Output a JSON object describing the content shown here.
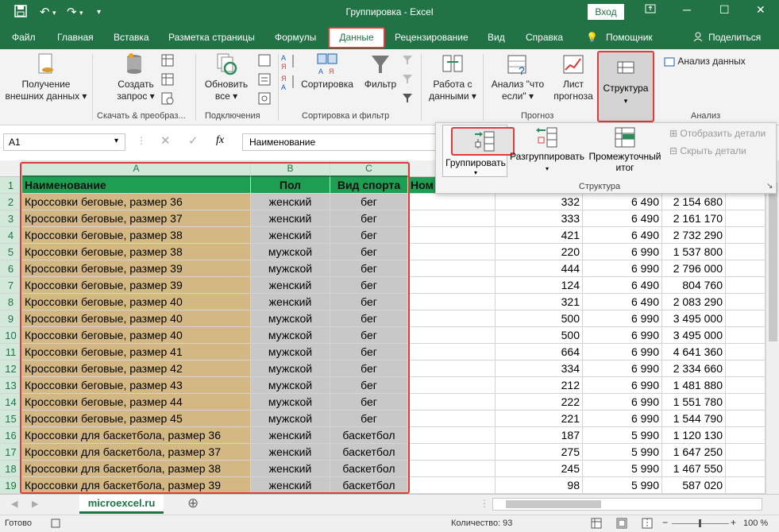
{
  "titlebar": {
    "title": "Группировка - Excel",
    "login": "Вход",
    "win_min": "─",
    "win_restore": "❐",
    "win_max": "☐",
    "win_close": "✕"
  },
  "tabs": {
    "file": "Файл",
    "home": "Главная",
    "insert": "Вставка",
    "layout": "Разметка страницы",
    "formulas": "Формулы",
    "data": "Данные",
    "review": "Рецензирование",
    "view": "Вид",
    "help": "Справка",
    "assistant": "Помощник",
    "share": "Поделиться"
  },
  "ribbon": {
    "get_data_1": "Получение",
    "get_data_2": "внешних данных",
    "create_query_1": "Создать",
    "create_query_2": "запрос",
    "group_download": "Скачать & преобраз...",
    "refresh_1": "Обновить",
    "refresh_2": "все",
    "group_connections": "Подключения",
    "sort": "Сортировка",
    "filter": "Фильтр",
    "group_sort": "Сортировка и фильтр",
    "datatools_1": "Работа с",
    "datatools_2": "данными",
    "whatif_1": "Анализ \"что",
    "whatif_2": "если\"",
    "forecast_1": "Лист",
    "forecast_2": "прогноза",
    "group_forecast": "Прогноз",
    "structure": "Структура",
    "analysis": "Анализ данных",
    "group_analysis": "Анализ"
  },
  "formulabar": {
    "namebox": "A1",
    "formula": "Наименование"
  },
  "struct_panel": {
    "group": "Группировать",
    "ungroup": "Разгруппировать",
    "subtotal_1": "Промежуточный",
    "subtotal_2": "итог",
    "show_detail": "Отобразить детали",
    "hide_detail": "Скрыть детали",
    "label": "Структура"
  },
  "grid": {
    "columns": [
      "A",
      "B",
      "C"
    ],
    "header": [
      "Наименование",
      "Пол",
      "Вид спорта",
      "Ном"
    ],
    "rows": [
      [
        "2",
        "Кроссовки беговые, размер 36",
        "женский",
        "бег",
        "332",
        "6 490",
        "2 154 680"
      ],
      [
        "3",
        "Кроссовки беговые, размер 37",
        "женский",
        "бег",
        "333",
        "6 490",
        "2 161 170"
      ],
      [
        "4",
        "Кроссовки беговые, размер 38",
        "женский",
        "бег",
        "421",
        "6 490",
        "2 732 290"
      ],
      [
        "5",
        "Кроссовки беговые, размер 38",
        "мужской",
        "бег",
        "220",
        "6 990",
        "1 537 800"
      ],
      [
        "6",
        "Кроссовки беговые, размер 39",
        "мужской",
        "бег",
        "444",
        "6 990",
        "2 796 000"
      ],
      [
        "7",
        "Кроссовки беговые, размер 39",
        "женский",
        "бег",
        "124",
        "6 490",
        "804 760"
      ],
      [
        "8",
        "Кроссовки беговые, размер 40",
        "женский",
        "бег",
        "321",
        "6 490",
        "2 083 290"
      ],
      [
        "9",
        "Кроссовки беговые, размер 40",
        "мужской",
        "бег",
        "500",
        "6 990",
        "3 495 000"
      ],
      [
        "10",
        "Кроссовки беговые, размер 40",
        "мужской",
        "бег",
        "500",
        "6 990",
        "3 495 000"
      ],
      [
        "11",
        "Кроссовки беговые, размер 41",
        "мужской",
        "бег",
        "664",
        "6 990",
        "4 641 360"
      ],
      [
        "12",
        "Кроссовки беговые, размер 42",
        "мужской",
        "бег",
        "334",
        "6 990",
        "2 334 660"
      ],
      [
        "13",
        "Кроссовки беговые, размер 43",
        "мужской",
        "бег",
        "212",
        "6 990",
        "1 481 880"
      ],
      [
        "14",
        "Кроссовки беговые, размер 44",
        "мужской",
        "бег",
        "222",
        "6 990",
        "1 551 780"
      ],
      [
        "15",
        "Кроссовки беговые, размер 45",
        "мужской",
        "бег",
        "221",
        "6 990",
        "1 544 790"
      ],
      [
        "16",
        "Кроссовки для баскетбола, размер 36",
        "женский",
        "баскетбол",
        "187",
        "5 990",
        "1 120 130"
      ],
      [
        "17",
        "Кроссовки для баскетбола, размер 37",
        "женский",
        "баскетбол",
        "275",
        "5 990",
        "1 647 250"
      ],
      [
        "18",
        "Кроссовки для баскетбола, размер 38",
        "женский",
        "баскетбол",
        "245",
        "5 990",
        "1 467 550"
      ],
      [
        "19",
        "Кроссовки для баскетбола, размер 39",
        "женский",
        "баскетбол",
        "98",
        "5 990",
        "587 020"
      ]
    ]
  },
  "sheet": {
    "tab": "microexcel.ru"
  },
  "status": {
    "ready": "Готово",
    "count": "Количество: 93",
    "zoom": "100 %"
  },
  "colors": {
    "excel_green": "#217346",
    "highlight_red": "#e23a3a",
    "header_green": "#1e9e52",
    "col_a_tan": "#d4b883",
    "col_bc_gray": "#c8c8c8"
  }
}
